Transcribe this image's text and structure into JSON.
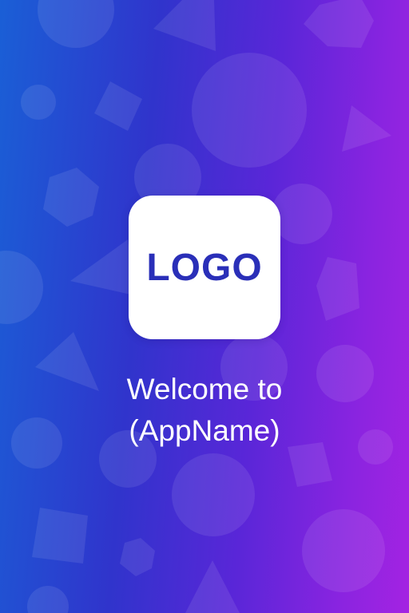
{
  "splash": {
    "logo_text": "LOGO",
    "welcome_line1": "Welcome to",
    "welcome_line2": "(AppName)"
  },
  "colors": {
    "gradient_start": "#1a5fd6",
    "gradient_end": "#a423e2",
    "logo_text": "#2a2fb8",
    "logo_tile": "#ffffff",
    "welcome_text": "#ffffff"
  }
}
